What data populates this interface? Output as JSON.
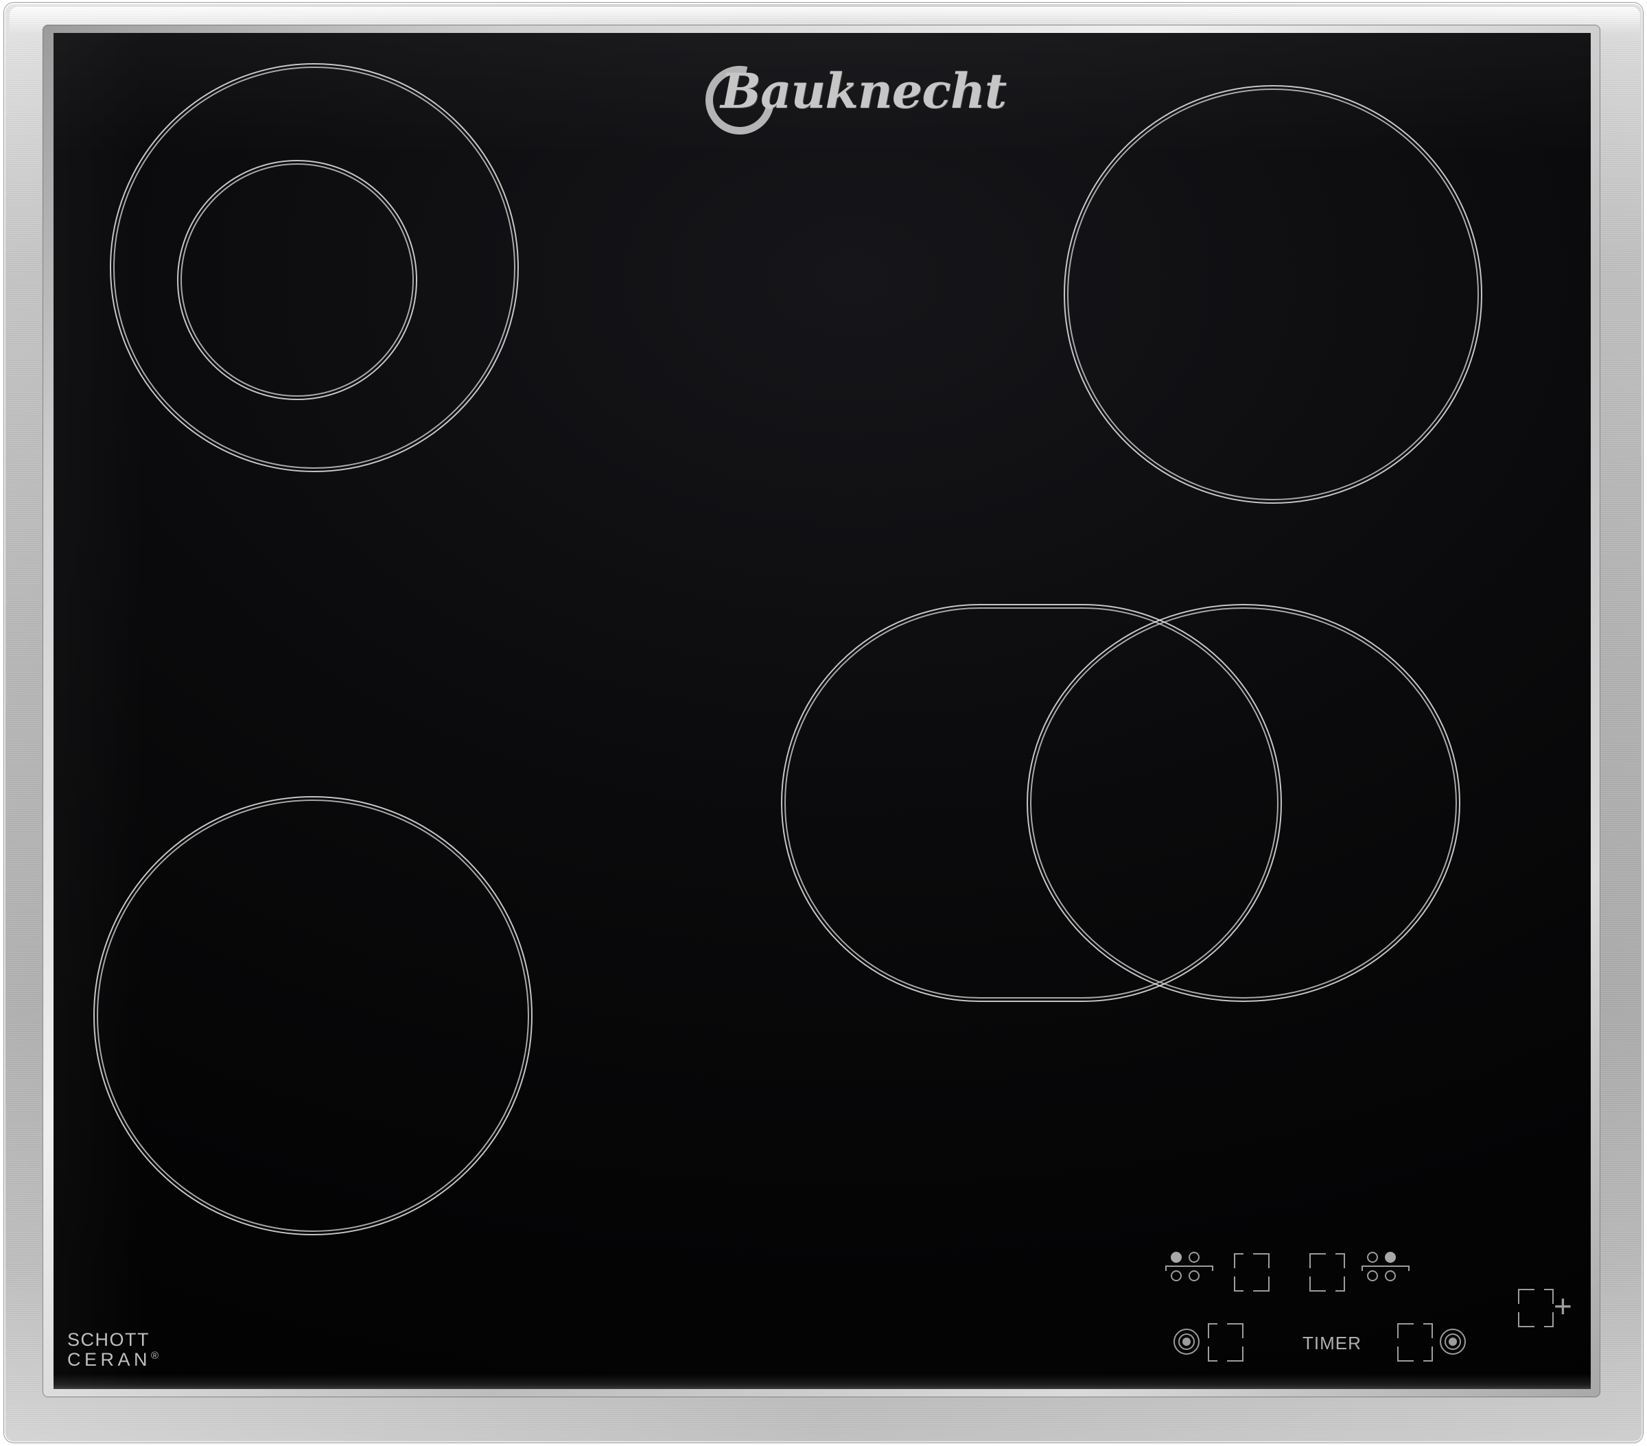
{
  "appliance": {
    "brand": "Bauknecht",
    "glass_brand_line1": "SCHOTT",
    "glass_brand_line2": "CERAN",
    "glass_brand_registered": "®",
    "surface_color": "#000000",
    "frame_color": "#cfcfcf",
    "marking_color": "#9c9c9c"
  },
  "cooking_zones": [
    {
      "name": "front-left-dual-zone",
      "type": "dual-circle",
      "position": "top-left"
    },
    {
      "name": "rear-right-single-zone",
      "type": "circle",
      "position": "top-right"
    },
    {
      "name": "front-left-single-zone",
      "type": "circle",
      "position": "bottom-left"
    },
    {
      "name": "front-right-extendable-zone",
      "type": "oval-plus-circle",
      "position": "bottom-right"
    }
  ],
  "control_panel": {
    "timer_label": "TIMER",
    "keys": [
      {
        "name": "zone-select-rear-left",
        "icon": "hob-map-icon",
        "selected_cell": 1,
        "label": ""
      },
      {
        "name": "zone-select-rear-right",
        "icon": "hob-map-icon",
        "selected_cell": 2,
        "label": ""
      },
      {
        "name": "zone-select-front-left",
        "icon": "hob-map-icon",
        "selected_cell": 3,
        "label": ""
      },
      {
        "name": "zone-select-front-right",
        "icon": "hob-map-icon",
        "selected_cell": 4,
        "label": ""
      },
      {
        "name": "timer-left-key",
        "icon": "concentric-rings-icon",
        "label": ""
      },
      {
        "name": "timer-right-key",
        "icon": "concentric-rings-icon",
        "label": ""
      },
      {
        "name": "plus-key",
        "icon": "plus-icon",
        "label": "+"
      },
      {
        "name": "minus-key",
        "icon": "minus-icon",
        "label": "−"
      },
      {
        "name": "key-lock-key",
        "icon": "key-lock-icon",
        "label": ""
      },
      {
        "name": "power-key",
        "icon": "power-icon",
        "label": ""
      }
    ]
  }
}
